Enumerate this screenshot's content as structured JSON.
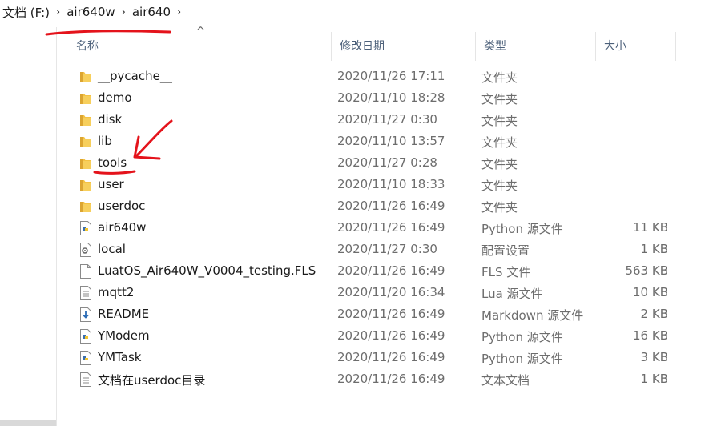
{
  "breadcrumb": {
    "items": [
      "文档 (F:)",
      "air640w",
      "air640"
    ],
    "separator": "›"
  },
  "columns": {
    "name": "名称",
    "date": "修改日期",
    "type": "类型",
    "size": "大小"
  },
  "files": [
    {
      "name": "__pycache__",
      "date": "2020/11/26 17:11",
      "type": "文件夹",
      "size": "",
      "icon": "folder-icon"
    },
    {
      "name": "demo",
      "date": "2020/11/10 18:28",
      "type": "文件夹",
      "size": "",
      "icon": "folder-icon"
    },
    {
      "name": "disk",
      "date": "2020/11/27 0:30",
      "type": "文件夹",
      "size": "",
      "icon": "folder-icon"
    },
    {
      "name": "lib",
      "date": "2020/11/10 13:57",
      "type": "文件夹",
      "size": "",
      "icon": "folder-icon"
    },
    {
      "name": "tools",
      "date": "2020/11/27 0:28",
      "type": "文件夹",
      "size": "",
      "icon": "folder-icon"
    },
    {
      "name": "user",
      "date": "2020/11/10 18:33",
      "type": "文件夹",
      "size": "",
      "icon": "folder-icon"
    },
    {
      "name": "userdoc",
      "date": "2020/11/26 16:49",
      "type": "文件夹",
      "size": "",
      "icon": "folder-icon"
    },
    {
      "name": "air640w",
      "date": "2020/11/26 16:49",
      "type": "Python 源文件",
      "size": "11 KB",
      "icon": "python-file-icon"
    },
    {
      "name": "local",
      "date": "2020/11/27 0:30",
      "type": "配置设置",
      "size": "1 KB",
      "icon": "config-file-icon"
    },
    {
      "name": "LuatOS_Air640W_V0004_testing.FLS",
      "date": "2020/11/26 16:49",
      "type": "FLS 文件",
      "size": "563 KB",
      "icon": "blank-file-icon"
    },
    {
      "name": "mqtt2",
      "date": "2020/11/20 16:34",
      "type": "Lua 源文件",
      "size": "10 KB",
      "icon": "text-file-icon"
    },
    {
      "name": "README",
      "date": "2020/11/26 16:49",
      "type": "Markdown 源文件",
      "size": "2 KB",
      "icon": "markdown-file-icon"
    },
    {
      "name": "YModem",
      "date": "2020/11/26 16:49",
      "type": "Python 源文件",
      "size": "16 KB",
      "icon": "python-file-icon"
    },
    {
      "name": "YMTask",
      "date": "2020/11/26 16:49",
      "type": "Python 源文件",
      "size": "3 KB",
      "icon": "python-file-icon"
    },
    {
      "name": "文档在userdoc目录",
      "date": "2020/11/26 16:49",
      "type": "文本文档",
      "size": "1 KB",
      "icon": "text-file-icon"
    }
  ],
  "colors": {
    "folder": "#f4c244",
    "folder_dark": "#dca531",
    "annotation": "#e4131b",
    "header_text": "#4c607a",
    "secondary_text": "#6d6d6d"
  }
}
